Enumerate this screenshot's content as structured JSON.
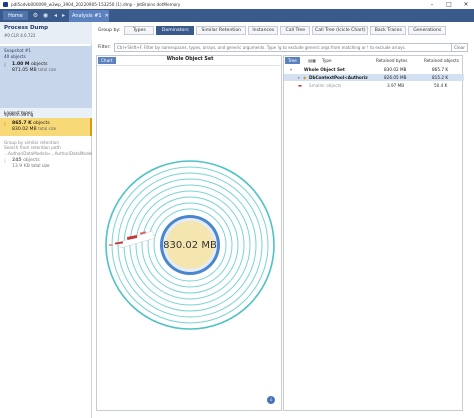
{
  "window": {
    "title": "pdl5odvb000099_w3wp_3904_20220905-153250 (1).dmp - JetBrains dotMemory",
    "minimize_glyph": "–",
    "maximize_glyph": "□",
    "close_glyph": "✕"
  },
  "topbar": {
    "home_label": "Home",
    "analysis_tab_label": "Analysis #1",
    "analysis_close_glyph": "✕"
  },
  "sidebar": {
    "process_title": "Process Dump",
    "process_subtitle": "#0 CLR 4.0.722",
    "snapshot_title": "Snapshot #1",
    "snapshot_sub": "40 objects",
    "m1_value": "1.00 M",
    "m1_unit": "objects",
    "m1_value2": "871.05 MB",
    "m1_unit2": "total size",
    "largest_label1": "Largest types",
    "largest_label2": "System.String",
    "m2_value": "865.7 K",
    "m2_unit": "objects",
    "m2_value2": "830.02 MB",
    "m2_unit2": "total size",
    "group_line1": "Group by similar retention",
    "group_line2": "Search from retention path",
    "group_line3": "...AuthoriDataModels»...AuthoriDataModels",
    "m3_value": "245",
    "m3_unit": "objects",
    "m3_value2": "13.9 KB",
    "m3_unit2": "total size"
  },
  "groupby": {
    "label": "Group by:",
    "tabs": [
      "Types",
      "Dominators",
      "Similar Retention",
      "Instances",
      "Call Tree",
      "Call Tree (Icicle Chart)",
      "Back Traces",
      "Generations"
    ],
    "active_index": 1
  },
  "filter": {
    "label": "Filter:",
    "placeholder": "Ctrl+Shift+F. Filter by namespaces, types, arrays, and generic arguments. Type !g to exclude generic args from matching or ! to exclude arrays.",
    "clear_label": "Clear"
  },
  "chart_panel": {
    "tab_label": "Chart",
    "title": "Whole Object Set",
    "center_label": "830.02 MB",
    "info_glyph": "i"
  },
  "tree_panel": {
    "tab_label": "Tree",
    "columns": [
      "Type",
      "Retained bytes",
      "Retained objects"
    ],
    "rows": [
      {
        "name": "Whole Object Set",
        "bytes": "830.02 MB",
        "objects": "865.7 K",
        "selected": false,
        "dim": false
      },
      {
        "name": "DbContextPool<Authoriz",
        "bytes": "826.05 MB",
        "objects": "815.2 K",
        "selected": true,
        "dim": false
      },
      {
        "name": "Smaller objects",
        "bytes": "3.97 MB",
        "objects": "50.4 K",
        "selected": false,
        "dim": true
      }
    ]
  },
  "colors": {
    "topbar": "#3a5a8c",
    "accent": "#5b82bf",
    "ring_outer": "#4ec2c4",
    "ring_inner": "#b6e4e6",
    "core_blue": "#4a86cf",
    "center_fill": "#f5e6b0",
    "selected_row": "#d3e1f3",
    "selected_metric": "#f7d977"
  }
}
